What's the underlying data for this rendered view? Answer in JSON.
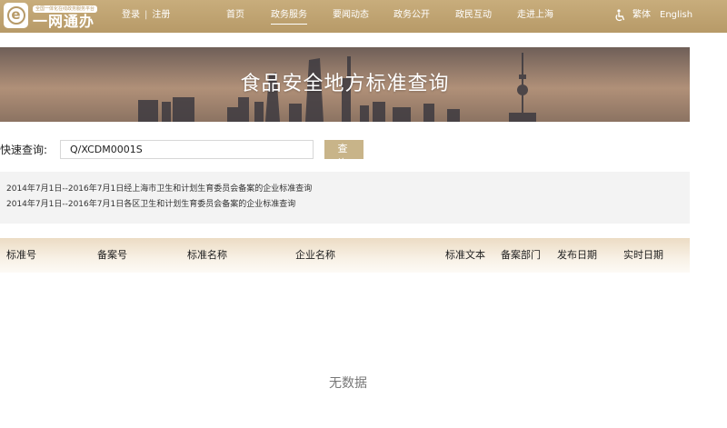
{
  "header": {
    "logo_tagline": "全国一体化在线政务服务平台",
    "logo_name": "一网通办",
    "login": "登录",
    "divider": "|",
    "register": "注册",
    "nav": [
      {
        "label": "首页"
      },
      {
        "label": "政务服务",
        "active": true
      },
      {
        "label": "要闻动态"
      },
      {
        "label": "政务公开"
      },
      {
        "label": "政民互动"
      },
      {
        "label": "走进上海"
      }
    ],
    "traditional": "繁体",
    "english": "English",
    "accessibility_icon": "wheelchair-icon",
    "brand_color": "#b79a68"
  },
  "banner": {
    "title": "食品安全地方标准查询"
  },
  "search": {
    "label": "快速查询:",
    "value": "Q/XCDM0001S",
    "button": "查 询",
    "button_color": "#c8b489"
  },
  "scope": {
    "lines": [
      "2014年7月1日--2016年7月1日经上海市卫生和计划生育委员会备案的企业标准查询",
      "2014年7月1日--2016年7月1日各区卫生和计划生育委员会备案的企业标准查询"
    ]
  },
  "table": {
    "columns": [
      "标准号",
      "备案号",
      "标准名称",
      "企业名称",
      "标准文本",
      "备案部门",
      "发布日期",
      "实时日期"
    ],
    "empty_text": "无数据"
  }
}
